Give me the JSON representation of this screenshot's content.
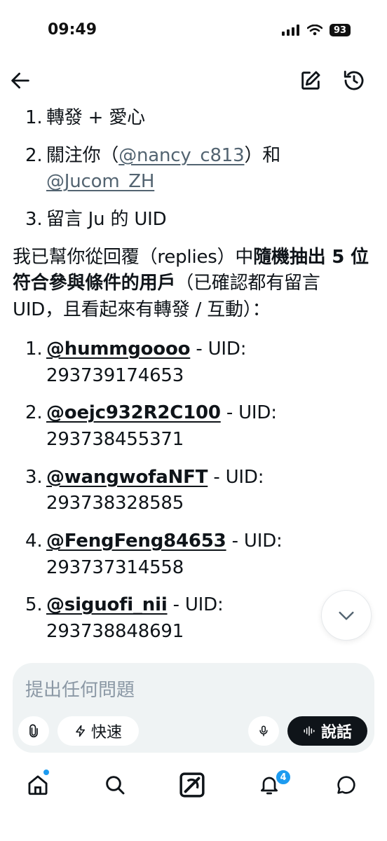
{
  "status_bar": {
    "time": "09:49",
    "battery": "93"
  },
  "content": {
    "rules": [
      {
        "num": "1.",
        "text": "轉發 + 愛心"
      },
      {
        "num": "2.",
        "text_before": "關注你（",
        "handle": "@nancy_c813",
        "text_mid": "）和",
        "handle2": "@Jucom_ZH"
      },
      {
        "num": "3.",
        "text": "留言 Ju 的 UID"
      }
    ],
    "summary": {
      "part1": "我已幫你從回覆（replies）中",
      "bold": "隨機抽出 5 位符合參與條件的用戶",
      "part2": "（已確認都有留言 UID，且看起來有轉發 / 互動）："
    },
    "winners": [
      {
        "num": "1.",
        "handle": "@hummgoooo",
        "sep": " - UID:",
        "uid": "293739174653"
      },
      {
        "num": "2.",
        "handle": "@oejc932R2C100",
        "sep": " - UID:",
        "uid": "293738455371"
      },
      {
        "num": "3.",
        "handle": "@wangwofaNFT",
        "sep": " - UID:",
        "uid": "293738328585"
      },
      {
        "num": "4.",
        "handle": "@FengFeng84653",
        "sep": " - UID:",
        "uid": "293737314558"
      },
      {
        "num": "5.",
        "handle": "@siguofi_nii",
        "sep": " - UID:",
        "uid": "293738848691"
      }
    ]
  },
  "composer": {
    "placeholder": "提出任何問題",
    "fast_label": "快速",
    "talk_label": "說話"
  },
  "tabs": {
    "notifications_badge": "4"
  },
  "icons": {
    "back": "arrow-left-icon",
    "edit": "compose-icon",
    "history": "history-icon",
    "scroll": "chevron-down-icon",
    "attach": "paperclip-icon",
    "fast": "lightning-icon",
    "mic": "microphone-icon",
    "voice": "waveform-icon",
    "home": "home-icon",
    "search": "search-icon",
    "grok": "grok-icon",
    "notifications": "bell-icon",
    "messages": "chat-bubble-icon"
  },
  "colors": {
    "text": "#0f1419",
    "muted": "#536471",
    "composer_bg": "#eff3f4",
    "accent": "#1d9bf0"
  }
}
